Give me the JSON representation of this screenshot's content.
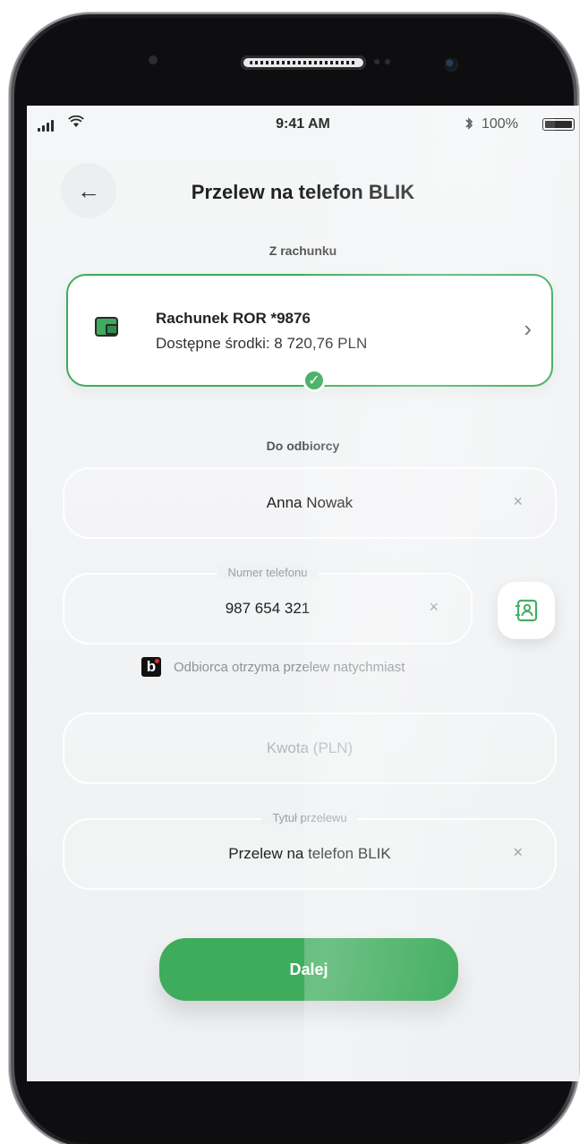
{
  "status_bar": {
    "time": "9:41 AM",
    "bluetooth_icon": "bluetooth-icon",
    "battery": "100%"
  },
  "header": {
    "back_icon": "←",
    "title": "Przelew na telefon BLIK"
  },
  "from_section": {
    "label": "Z rachunku",
    "account": {
      "name": "Rachunek ROR *9876",
      "balance": "Dostępne środki: 8 720,76 PLN",
      "icon": "wallet-icon",
      "chevron": "›"
    }
  },
  "to_section": {
    "label": "Do odbiorcy",
    "recipient_name": "Anna Nowak",
    "phone_legend": "Numer telefonu",
    "phone_value": "987 654 321",
    "clear_glyph": "×",
    "blik_info": "Odbiorca otrzyma przelew natychmiast",
    "blik_logo_letter": "b"
  },
  "amount": {
    "placeholder": "Kwota (PLN)"
  },
  "title_field": {
    "legend": "Tytuł przelewu",
    "value": "Przelew na telefon BLIK"
  },
  "actions": {
    "next_label": "Dalej"
  },
  "colors": {
    "accent": "#3eac5c",
    "frame": "#1b1c1e",
    "background": "#f2f4f5"
  }
}
